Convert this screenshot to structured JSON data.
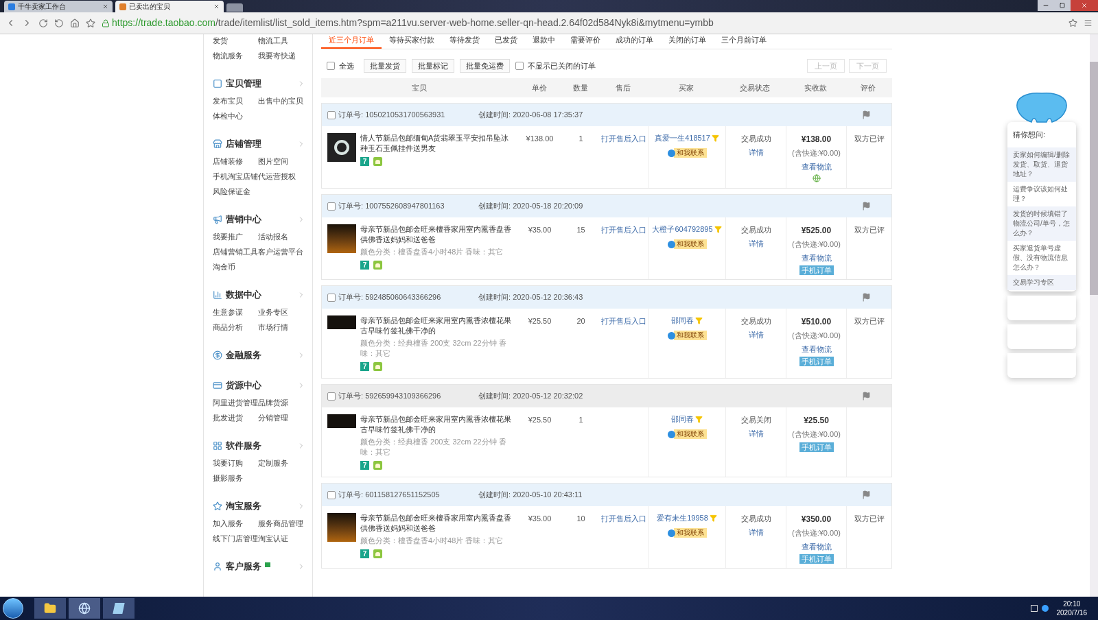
{
  "browser": {
    "tabs": [
      {
        "label": "千牛卖家工作台",
        "selected": false
      },
      {
        "label": "已卖出的宝贝",
        "selected": true
      }
    ],
    "url_host": "https://trade.taobao.com",
    "url_path": "/trade/itemlist/list_sold_items.htm?spm=a211vu.server-web-home.seller-qn-head.2.64f02d584Nyk8i&mytmenu=ymbb"
  },
  "sidebar": [
    {
      "items": [
        "发货",
        "物流工具",
        "物流服务",
        "我要寄快递"
      ]
    },
    {
      "title": "宝贝管理",
      "items": [
        "发布宝贝",
        "出售中的宝贝",
        "体检中心"
      ]
    },
    {
      "title": "店铺管理",
      "items": [
        "店铺装修",
        "图片空间",
        "手机淘宝店铺",
        "代运营授权",
        "风险保证金"
      ]
    },
    {
      "title": "营销中心",
      "items": [
        "我要推广",
        "活动报名",
        "店铺营销工具",
        "客户运营平台",
        "淘金币"
      ]
    },
    {
      "title": "数据中心",
      "items": [
        "生意参谋",
        "业务专区",
        "商品分析",
        "市场行情"
      ]
    },
    {
      "title": "金融服务"
    },
    {
      "title": "货源中心",
      "items": [
        "阿里进货管理",
        "品牌货源",
        "批发进货",
        "分销管理"
      ]
    },
    {
      "title": "软件服务",
      "items": [
        "我要订购",
        "定制服务",
        "摄影服务"
      ]
    },
    {
      "title": "淘宝服务",
      "items": [
        "加入服务",
        "服务商品管理",
        "线下门店管理",
        "淘宝认证"
      ]
    },
    {
      "title": "客户服务",
      "chat": true
    }
  ],
  "order_tabs": [
    {
      "label": "近三个月订单",
      "selected": true
    },
    {
      "label": "等待买家付款",
      "selected": false
    },
    {
      "label": "等待发货",
      "selected": false
    },
    {
      "label": "已发货",
      "selected": false
    },
    {
      "label": "退款中",
      "selected": false
    },
    {
      "label": "需要评价",
      "selected": false
    },
    {
      "label": "成功的订单",
      "selected": false
    },
    {
      "label": "关闭的订单",
      "selected": false
    },
    {
      "label": "三个月前订单",
      "selected": false
    }
  ],
  "toolbar": {
    "select_all": {
      "label": "全选",
      "checked": false
    },
    "buttons": [
      "批量发货",
      "批量标记",
      "批量免运费"
    ],
    "hide_closed": {
      "label": "不显示已关闭的订单",
      "checked": false
    },
    "prev": "上一页",
    "next": "下一页"
  },
  "columns": [
    "宝贝",
    "单价",
    "数量",
    "售后",
    "买家",
    "交易状态",
    "实收款",
    "评价"
  ],
  "orders": [
    {
      "checked": false,
      "closed": false,
      "order_no_label": "订单号:",
      "order_no": "1050210531700563931",
      "created_label": "创建时间:",
      "created": "2020-06-08 17:35:37",
      "title": "情人节新品包邮缅甸A货翡翠玉平安扣吊坠冰种玉石玉佩挂件送男友",
      "price": "¥138.00",
      "qty": "1",
      "after_sale": "打开售后入口",
      "buyer": "真爱一生418517",
      "contact": "和我联系",
      "status": "交易成功",
      "detail": "详情",
      "total": "¥138.00",
      "shipping": "(含快递:¥0.00)",
      "logistics": "查看物流",
      "globe": true,
      "rating": "双方已评",
      "badge": "7"
    },
    {
      "checked": false,
      "closed": false,
      "order_no_label": "订单号:",
      "order_no": "1007552608947801163",
      "created_label": "创建时间:",
      "created": "2020-05-18 20:20:09",
      "title": "母亲节新品包邮金旺来檀香家用室内熏香盘香供佛香送妈妈和送爸爸",
      "spec": "颜色分类：檀香盘香4小时48片  香味：其它",
      "price": "¥35.00",
      "qty": "15",
      "after_sale": "打开售后入口",
      "buyer": "大橙子604792895",
      "contact": "和我联系",
      "status": "交易成功",
      "detail": "详情",
      "total": "¥525.00",
      "shipping": "(含快递:¥0.00)",
      "logistics": "查看物流",
      "mobile": "手机订单",
      "globe": false,
      "rating": "双方已评",
      "badge": "7"
    },
    {
      "checked": false,
      "closed": false,
      "order_no_label": "订单号:",
      "order_no": "592485060643366296",
      "created_label": "创建时间:",
      "created": "2020-05-12 20:36:43",
      "title": "母亲节新品包邮金旺来家用室内熏香浓檀花果古早味竹签礼佛干净的",
      "spec": "颜色分类：经典檀香 200支 32cm 22分钟  香味：其它",
      "price": "¥25.50",
      "qty": "20",
      "after_sale": "打开售后入口",
      "buyer": "邵同春",
      "contact": "和我联系",
      "status": "交易成功",
      "detail": "详情",
      "total": "¥510.00",
      "shipping": "(含快递:¥0.00)",
      "logistics": "查看物流",
      "mobile": "手机订单",
      "globe": false,
      "rating": "双方已评",
      "badge": "7"
    },
    {
      "checked": false,
      "closed": true,
      "order_no_label": "订单号:",
      "order_no": "592659943109366296",
      "created_label": "创建时间:",
      "created": "2020-05-12 20:32:02",
      "title": "母亲节新品包邮金旺来家用室内熏香浓檀花果古早味竹签礼佛干净的",
      "spec": "颜色分类：经典檀香 200支 32cm 22分钟  香味：其它",
      "price": "¥25.50",
      "qty": "1",
      "buyer": "邵同春",
      "contact": "和我联系",
      "status": "交易关闭",
      "detail": "详情",
      "total": "¥25.50",
      "shipping": "(含快递:¥0.00)",
      "mobile": "手机订单",
      "globe": false,
      "badge": "7"
    },
    {
      "checked": false,
      "closed": false,
      "order_no_label": "订单号:",
      "order_no": "601158127651152505",
      "created_label": "创建时间:",
      "created": "2020-05-10 20:43:11",
      "title": "母亲节新品包邮金旺来檀香家用室内熏香盘香供佛香送妈妈和送爸爸",
      "spec": "颜色分类：檀香盘香4小时48片  香味：其它",
      "price": "¥35.00",
      "qty": "10",
      "after_sale": "打开售后入口",
      "buyer": "爱有未生19958",
      "contact": "和我联系",
      "status": "交易成功",
      "detail": "详情",
      "total": "¥350.00",
      "shipping": "(含快递:¥0.00)",
      "logistics": "查看物流",
      "mobile": "手机订单",
      "globe": false,
      "rating": "双方已评",
      "badge": "7"
    }
  ],
  "helper": {
    "title": "猜你想问:",
    "questions": [
      "卖家如何编辑/删除发货、取货、退货地址？",
      "运费争议该如何处理？",
      "发货的时候填错了物流公司/单号，怎么办？",
      "买家退货单号虚假、没有物流信息怎么办？",
      "交易学习专区"
    ]
  },
  "taskbar": {
    "time": "20:10",
    "date": "2020/7/16"
  }
}
